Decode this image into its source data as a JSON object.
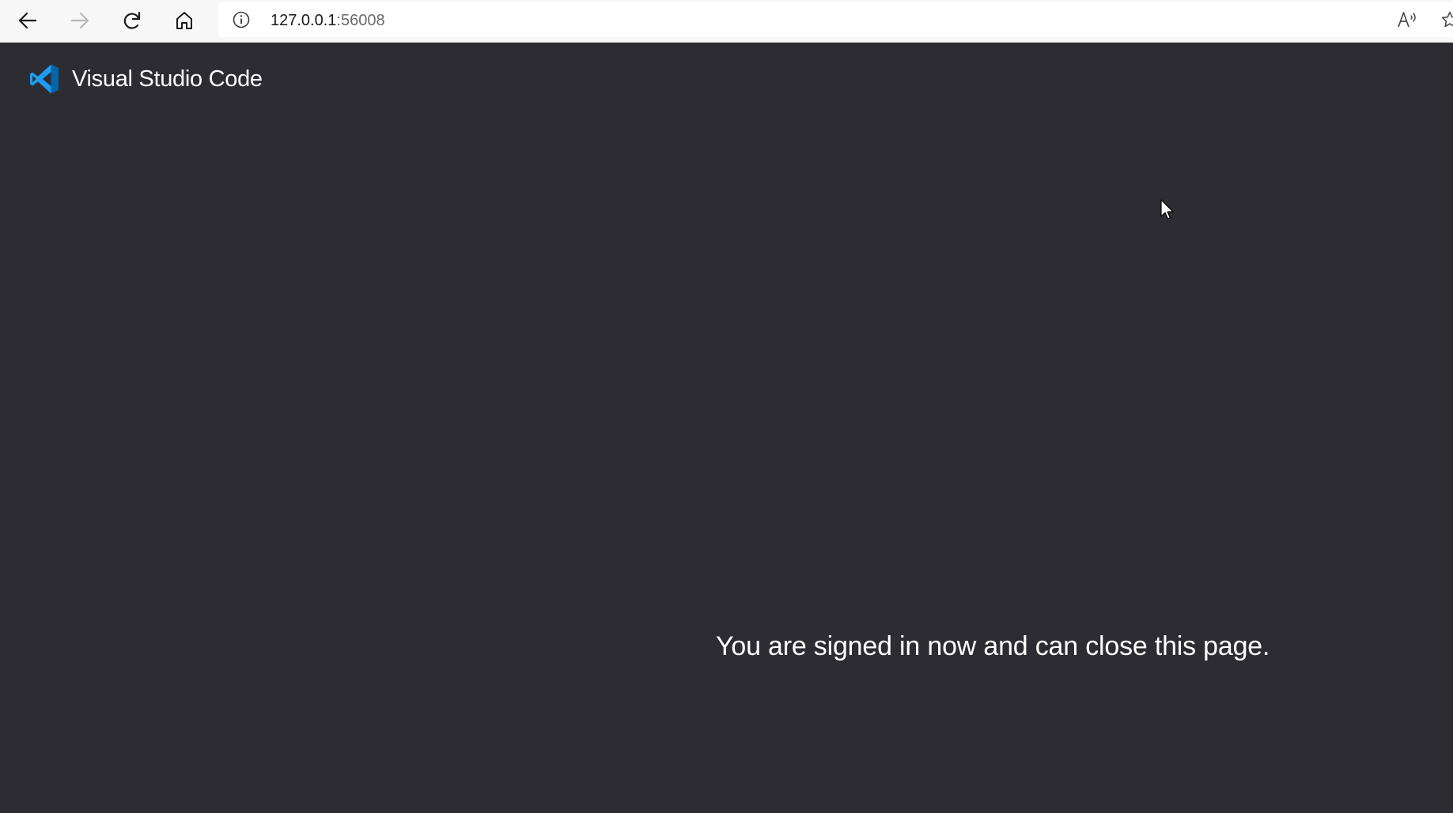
{
  "browser": {
    "url_host": "127.0.0.1",
    "url_port": ":56008",
    "icons": {
      "back": "back-arrow-icon",
      "forward": "forward-arrow-icon",
      "refresh": "refresh-icon",
      "home": "home-icon",
      "site_info": "info-icon",
      "read_aloud": "read-aloud-icon",
      "favorite": "star-icon"
    }
  },
  "page": {
    "brand_title": "Visual Studio Code",
    "message": "You are signed in now and can close this page.",
    "colors": {
      "background": "#2d2c32",
      "text": "#ffffff",
      "logo_blue": "#1f9cf0",
      "logo_dark_blue": "#0065a9"
    }
  }
}
